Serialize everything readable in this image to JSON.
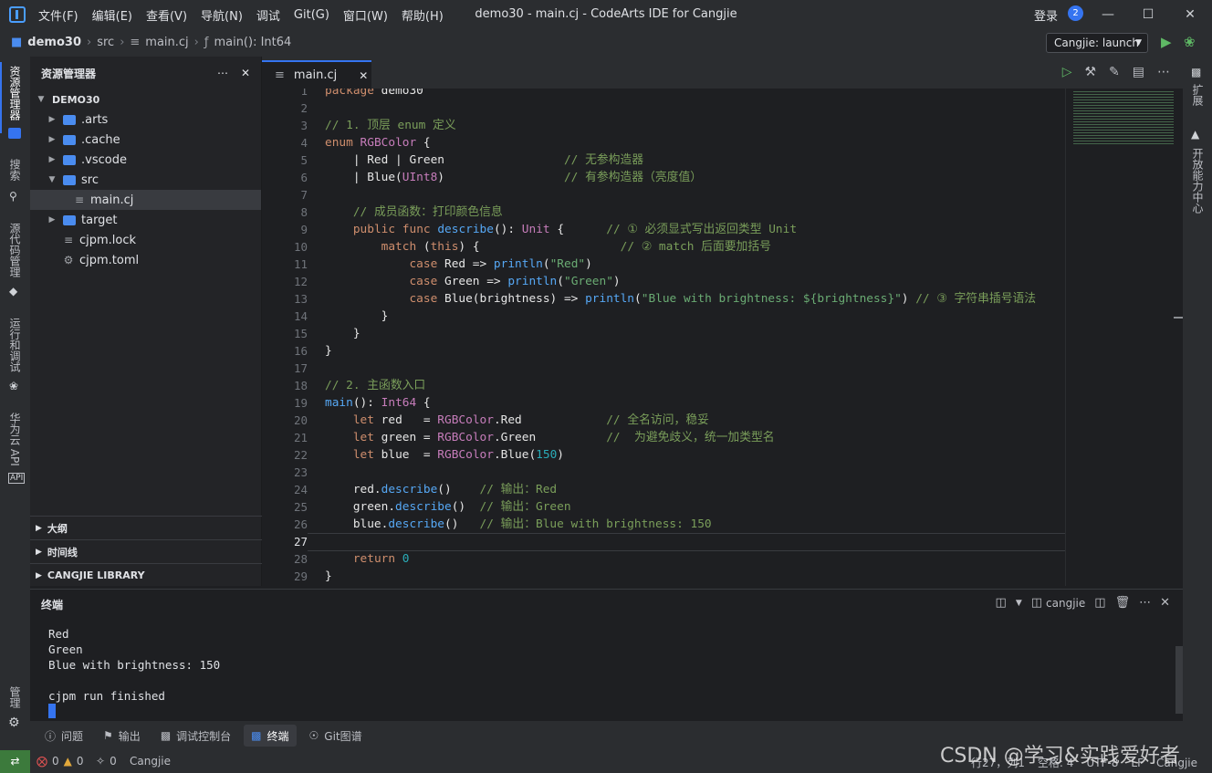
{
  "window": {
    "title": "demo30 - main.cj - CodeArts IDE for Cangjie",
    "menus": [
      "文件(F)",
      "编辑(E)",
      "查看(V)",
      "导航(N)",
      "调试",
      "Git(G)",
      "窗口(W)",
      "帮助(H)"
    ],
    "login": "登录",
    "notification_count": "2"
  },
  "breadcrumb": {
    "project": "demo30",
    "folder": "src",
    "file": "main.cj",
    "symbol": "main(): Int64"
  },
  "run_config": "Cangjie: launch",
  "activity_bar": [
    "资源管理器",
    "搜索",
    "源代码管理",
    "运行和调试",
    "华为云 API",
    "管理"
  ],
  "right_bar": [
    "扩展",
    "开放能力中心"
  ],
  "explorer": {
    "title": "资源管理器",
    "root": "DEMO30",
    "items": [
      {
        "label": ".arts",
        "kind": "folder",
        "level": 1
      },
      {
        "label": ".cache",
        "kind": "folder",
        "level": 1
      },
      {
        "label": ".vscode",
        "kind": "folder",
        "level": 1
      },
      {
        "label": "src",
        "kind": "folder-open",
        "level": 1
      },
      {
        "label": "main.cj",
        "kind": "file",
        "level": 2
      },
      {
        "label": "target",
        "kind": "folder",
        "level": 1
      },
      {
        "label": "cjpm.lock",
        "kind": "file",
        "level": 1
      },
      {
        "label": "cjpm.toml",
        "kind": "gear-file",
        "level": 1
      }
    ],
    "sections": [
      "大纲",
      "时间线",
      "CANGJIE LIBRARY"
    ]
  },
  "editor": {
    "tab": "main.cj",
    "line_numbers": [
      "1",
      "2",
      "3",
      "4",
      "5",
      "6",
      "7",
      "8",
      "9",
      "10",
      "11",
      "12",
      "13",
      "14",
      "15",
      "16",
      "17",
      "18",
      "19",
      "20",
      "21",
      "22",
      "23",
      "24",
      "25",
      "26",
      "27",
      "28",
      "29"
    ],
    "lines": [
      "package demo30",
      "",
      "// 1. 顶层 enum 定义",
      "enum RGBColor {",
      "    | Red | Green                 // 无参构造器",
      "    | Blue(UInt8)                 // 有参构造器（亮度值）",
      "",
      "    // 成员函数：打印颜色信息",
      "    public func describe(): Unit {      // ① 必须显式写出返回类型 Unit",
      "        match (this) {                    // ② match 后面要加括号",
      "            case Red => println(\"Red\")",
      "            case Green => println(\"Green\")",
      "            case Blue(brightness) => println(\"Blue with brightness: ${brightness}\") // ③ 字符串插号语法",
      "        }",
      "    }",
      "}",
      "",
      "// 2. 主函数入口",
      "main(): Int64 {",
      "    let red   = RGBColor.Red            // 全名访问，稳妥",
      "    let green = RGBColor.Green          //  为避免歧义，统一加类型名",
      "    let blue  = RGBColor.Blue(150)",
      "",
      "    red.describe()    // 输出：Red",
      "    green.describe()  // 输出：Green",
      "    blue.describe()   // 输出：Blue with brightness: 150",
      "",
      "    return 0",
      "}"
    ]
  },
  "terminal": {
    "title": "终端",
    "shell": "cangjie",
    "output": [
      "Red",
      "Green",
      "Blue with brightness: 150",
      "",
      "cjpm run finished"
    ]
  },
  "panel_tabs": [
    "问题",
    "输出",
    "调试控制台",
    "终端",
    "Git图谱"
  ],
  "status": {
    "errors": "0",
    "warnings": "0",
    "ports": "0",
    "language": "Cangjie",
    "cursor": "行27，列1",
    "indent": "空格: 4",
    "encoding": "UTF-8",
    "eol": "LF",
    "mode": "Cangjie"
  },
  "watermark": "CSDN @学习&实践爱好者",
  "colors": {
    "accent": "#3574f0",
    "bg": "#1e1f22",
    "panel": "#2b2d30"
  }
}
